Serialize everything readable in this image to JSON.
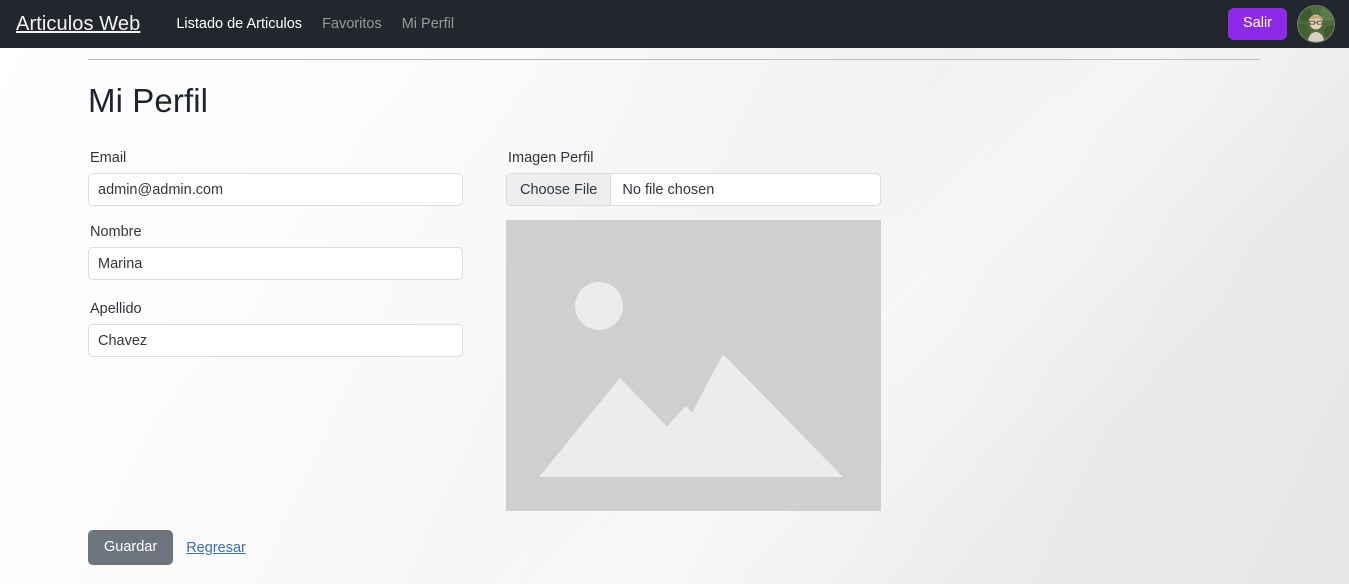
{
  "navbar": {
    "brand": "Articulos Web",
    "links": [
      {
        "label": "Listado de Articulos",
        "active": true
      },
      {
        "label": "Favoritos",
        "active": false
      },
      {
        "label": "Mi Perfil",
        "active": false
      }
    ],
    "logout_label": "Salir",
    "avatar_alt": "user-avatar",
    "background_color": "#23262d",
    "logout_color": "#8b2be8"
  },
  "page": {
    "title": "Mi Perfil"
  },
  "form": {
    "email": {
      "label": "Email",
      "value": "admin@admin.com",
      "placeholder": ""
    },
    "nombre": {
      "label": "Nombre",
      "value": "Marina",
      "placeholder": ""
    },
    "apellido": {
      "label": "Apellido",
      "value": "Chavez",
      "placeholder": ""
    },
    "imagen": {
      "label": "Imagen Perfil",
      "choose_button": "Choose File",
      "file_status": "No file chosen",
      "preview_alt": "image-placeholder"
    }
  },
  "actions": {
    "save_label": "Guardar",
    "back_label": "Regresar",
    "save_color": "#6c757d",
    "back_color": "#3b6fb6"
  }
}
